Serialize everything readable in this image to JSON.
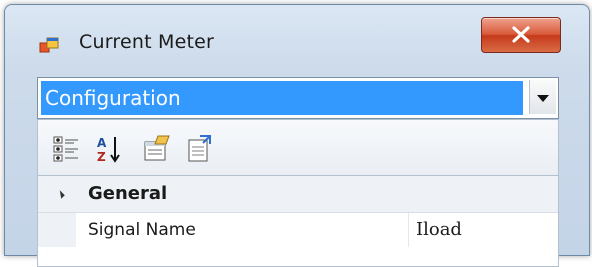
{
  "window": {
    "title": "Current Meter",
    "icon": "app-window-icon",
    "close_icon": "close-icon"
  },
  "selector": {
    "value": "Configuration",
    "arrow_icon": "chevron-down-icon",
    "highlight_color": "#3399ff"
  },
  "toolbar": {
    "buttons": [
      {
        "name": "categorized-view-button",
        "icon": "categorized-icon"
      },
      {
        "name": "alphabetical-sort-button",
        "icon": "sort-az-icon"
      },
      {
        "name": "properties-button",
        "icon": "properties-icon"
      },
      {
        "name": "property-pages-button",
        "icon": "property-pages-icon"
      }
    ]
  },
  "grid": {
    "category": "General",
    "rows": [
      {
        "name": "Signal Name",
        "value": "Iload"
      }
    ]
  },
  "colors": {
    "close_button": "#d8593b",
    "window_frame": "#cddbeb"
  }
}
